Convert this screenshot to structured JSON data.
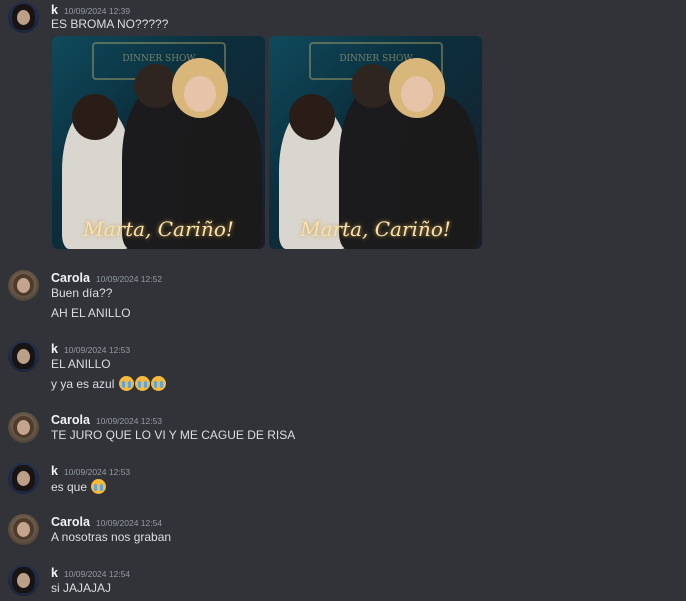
{
  "messages": [
    {
      "author": "k",
      "time": "10/09/2024 12:39",
      "lines": [
        "ES BROMA NO?????"
      ],
      "attachments": [
        {
          "caption": "Marta, Cariño!",
          "sign": "DINNER SHOW"
        },
        {
          "caption": "Marta, Cariño!",
          "sign": "DINNER SHOW"
        }
      ]
    },
    {
      "author": "Carola",
      "time": "10/09/2024 12:52",
      "lines": [
        "Buen día??",
        "AH EL ANILLO"
      ]
    },
    {
      "author": "k",
      "time": "10/09/2024 12:53",
      "lines": [
        "EL ANILLO",
        "y ya es azul"
      ]
    },
    {
      "author": "Carola",
      "time": "10/09/2024 12:53",
      "lines": [
        "TE JURO QUE LO VI Y ME CAGUE DE RISA"
      ]
    },
    {
      "author": "k",
      "time": "10/09/2024 12:53",
      "lines": [
        "es que"
      ]
    },
    {
      "author": "Carola",
      "time": "10/09/2024 12:54",
      "lines": [
        "A nosotras nos graban"
      ]
    },
    {
      "author": "k",
      "time": "10/09/2024 12:54",
      "lines": [
        "si JAJAJAJ"
      ]
    }
  ],
  "emoji": {
    "name": "loudly-crying-face-emoji",
    "color": "#f6b93b"
  }
}
